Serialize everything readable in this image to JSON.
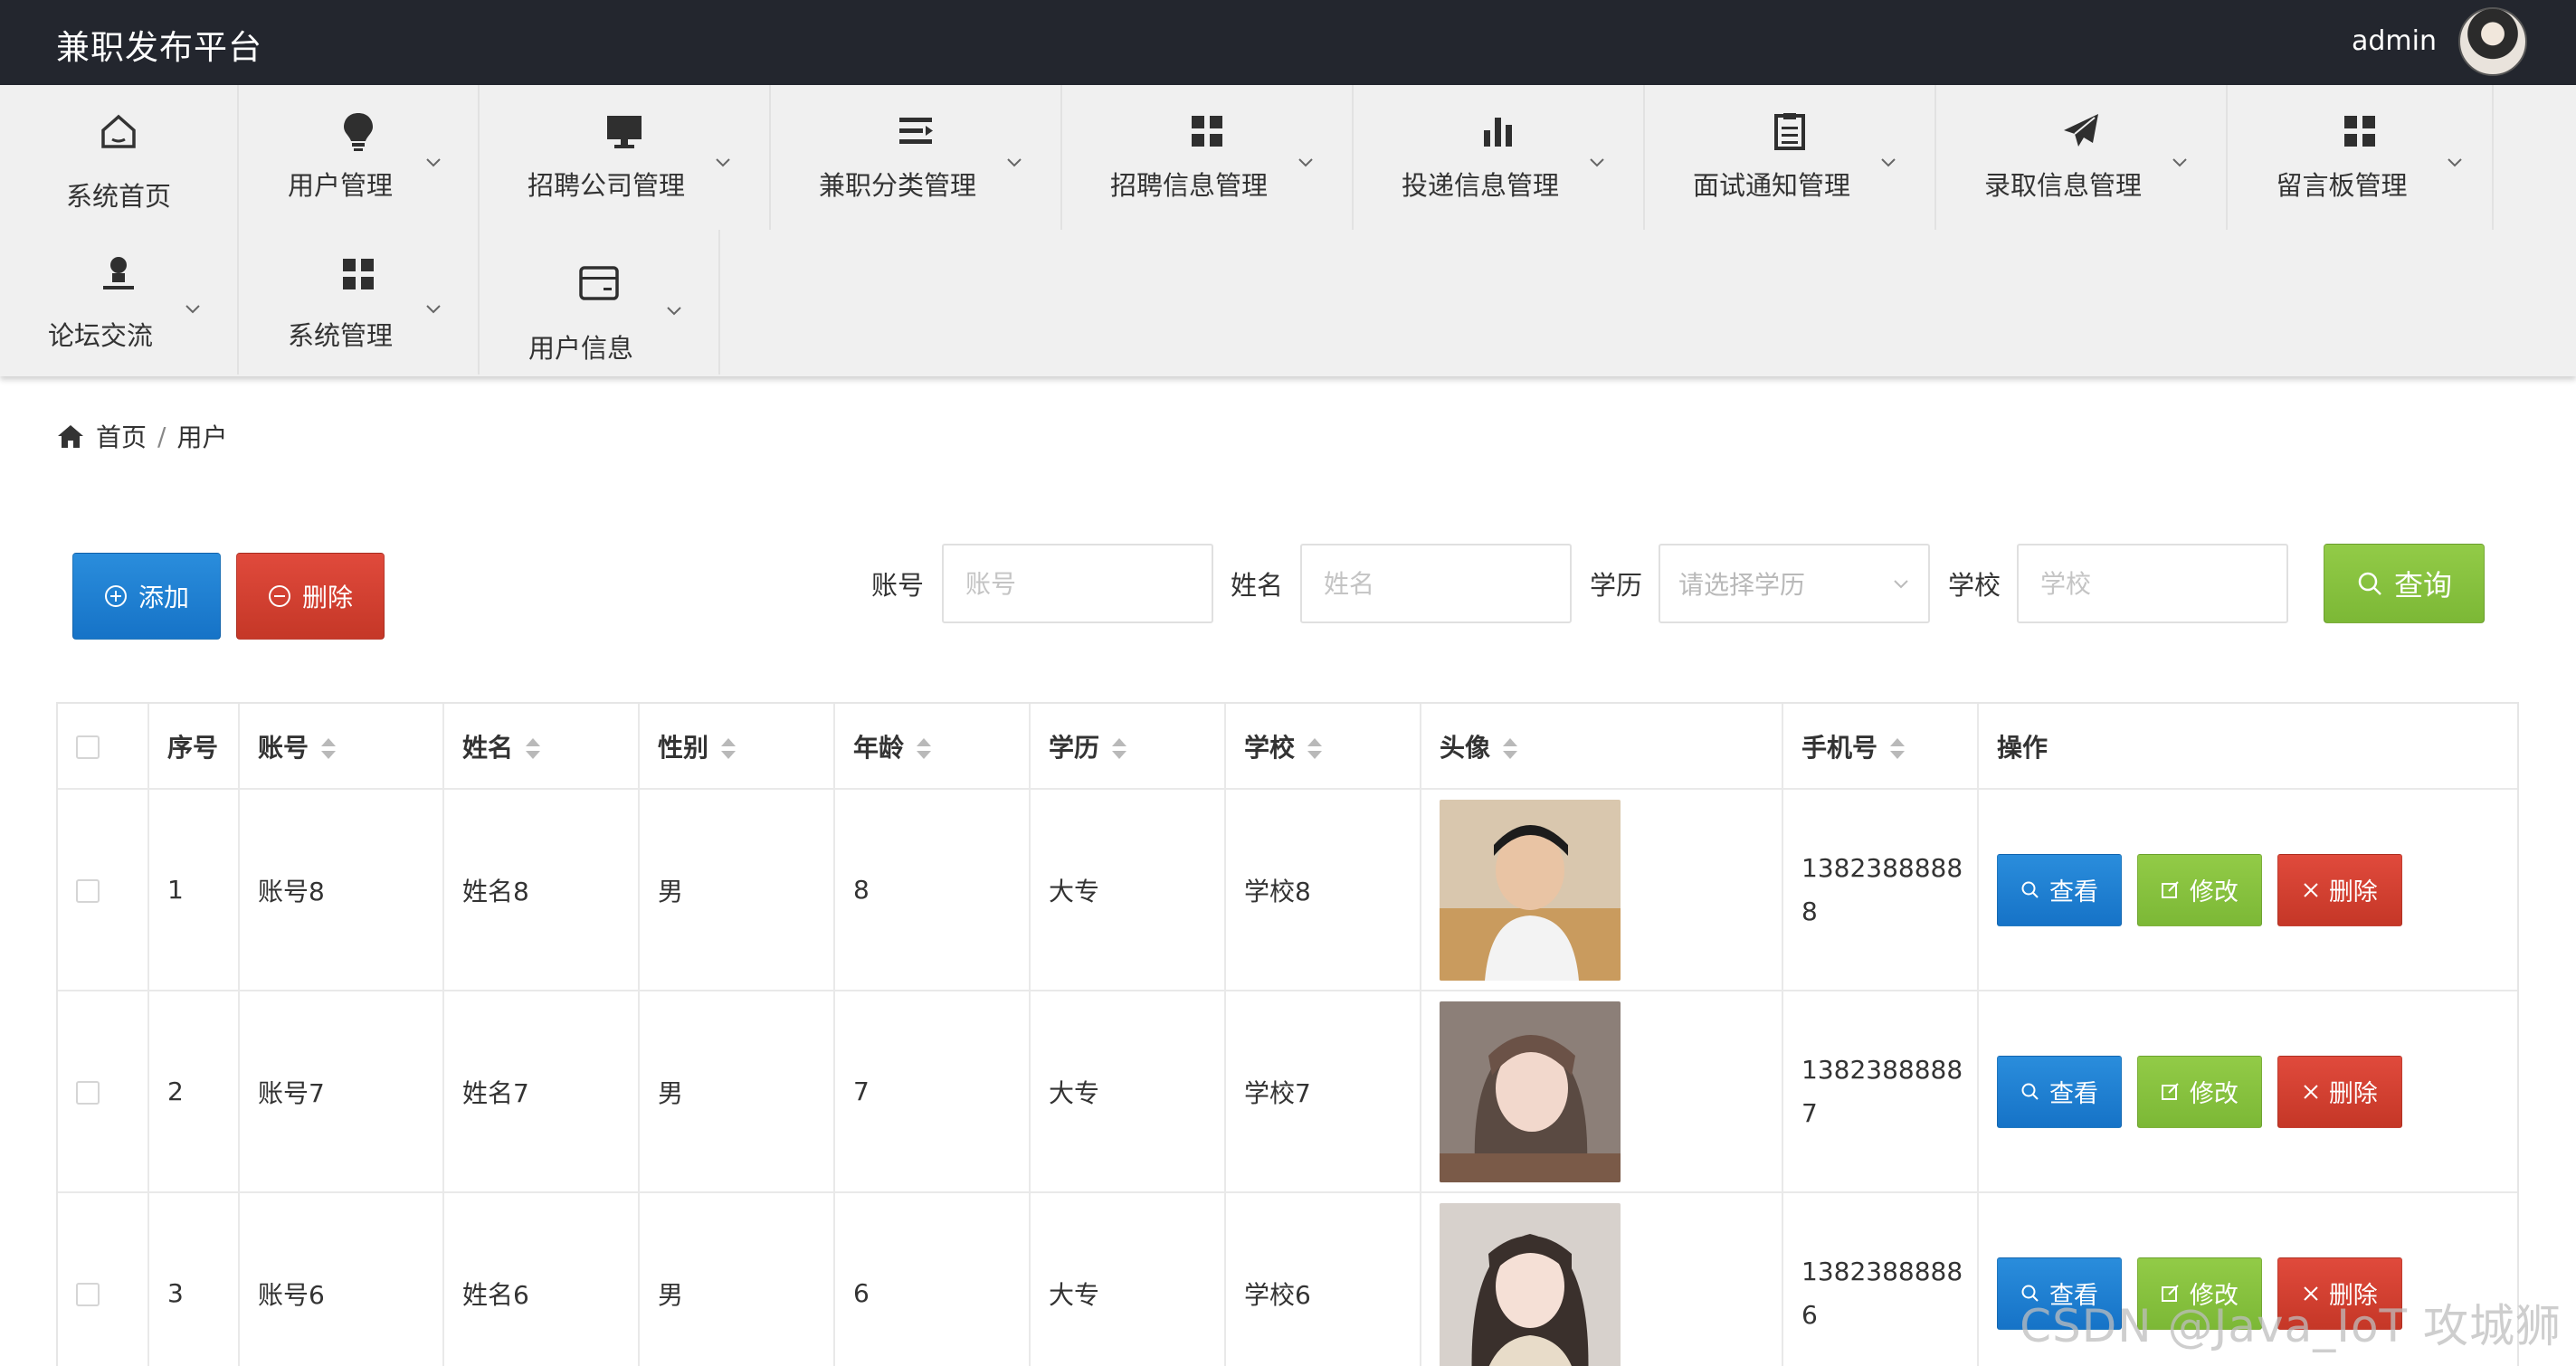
{
  "app": {
    "title": "兼职发布平台",
    "user": "admin"
  },
  "nav": {
    "items": [
      {
        "label": "系统首页",
        "icon": "home-icon"
      },
      {
        "label": "用户管理",
        "icon": "lightbulb-icon"
      },
      {
        "label": "招聘公司管理",
        "icon": "desktop-icon"
      },
      {
        "label": "兼职分类管理",
        "icon": "list-icon"
      },
      {
        "label": "招聘信息管理",
        "icon": "grid-icon"
      },
      {
        "label": "投递信息管理",
        "icon": "bar-chart-icon"
      },
      {
        "label": "面试通知管理",
        "icon": "clipboard-icon"
      },
      {
        "label": "录取信息管理",
        "icon": "paper-plane-icon"
      },
      {
        "label": "留言板管理",
        "icon": "grid-icon"
      },
      {
        "label": "论坛交流",
        "icon": "user-icon"
      },
      {
        "label": "系统管理",
        "icon": "grid-icon"
      },
      {
        "label": "用户信息",
        "icon": "card-icon"
      }
    ]
  },
  "breadcrumb": {
    "home": "首页",
    "sep": "/",
    "current": "用户"
  },
  "actions": {
    "add": "添加",
    "delete": "删除",
    "search": "查询"
  },
  "search": {
    "account_label": "账号",
    "account_placeholder": "账号",
    "name_label": "姓名",
    "name_placeholder": "姓名",
    "edu_label": "学历",
    "edu_placeholder": "请选择学历",
    "school_label": "学校",
    "school_placeholder": "学校"
  },
  "table": {
    "headers": [
      "序号",
      "账号",
      "姓名",
      "性别",
      "年龄",
      "学历",
      "学校",
      "头像",
      "手机号",
      "操作"
    ],
    "rows": [
      {
        "no": "1",
        "account": "账号8",
        "name": "姓名8",
        "gender": "男",
        "age": "8",
        "edu": "大专",
        "school": "学校8",
        "phone1": "1382388888",
        "phone2": "8"
      },
      {
        "no": "2",
        "account": "账号7",
        "name": "姓名7",
        "gender": "男",
        "age": "7",
        "edu": "大专",
        "school": "学校7",
        "phone1": "1382388888",
        "phone2": "7"
      },
      {
        "no": "3",
        "account": "账号6",
        "name": "姓名6",
        "gender": "男",
        "age": "6",
        "edu": "大专",
        "school": "学校6",
        "phone1": "1382388888",
        "phone2": "6"
      }
    ],
    "ops": {
      "view": "查看",
      "edit": "修改",
      "delete": "删除"
    }
  },
  "watermark": "CSDN @Java_IoT 攻城狮",
  "colors": {
    "topbar": "#23262e",
    "blue": "#1e7fd0",
    "red": "#d34233",
    "green": "#86c03f"
  }
}
